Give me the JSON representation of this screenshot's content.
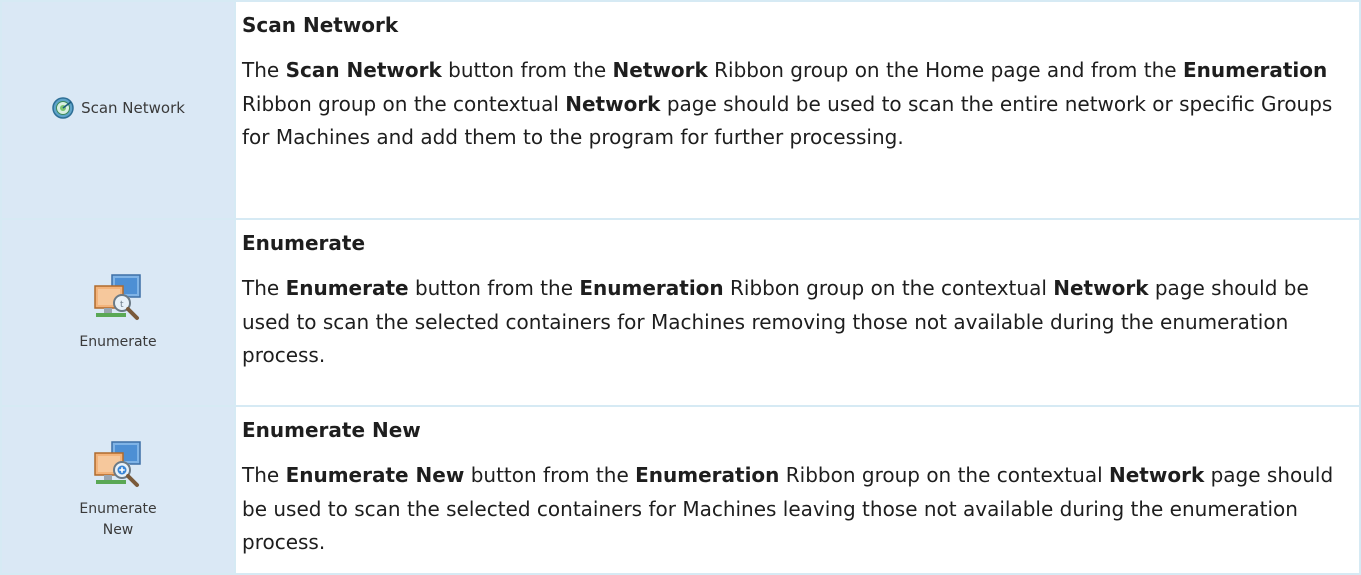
{
  "entries": [
    {
      "button_label": "Scan Network",
      "icon": "scan-network-icon",
      "title": "Scan Network",
      "body": [
        {
          "t": "The ",
          "b": false
        },
        {
          "t": "Scan Network",
          "b": true
        },
        {
          "t": " button from the ",
          "b": false
        },
        {
          "t": "Network",
          "b": true
        },
        {
          "t": " Ribbon group on the Home page and from the ",
          "b": false
        },
        {
          "t": "Enumeration",
          "b": true
        },
        {
          "t": " Ribbon group on the contextual ",
          "b": false
        },
        {
          "t": "Network",
          "b": true
        },
        {
          "t": " page should be used to scan the entire network or specific Groups for Machines and add them to the program for further processing.",
          "b": false
        }
      ]
    },
    {
      "button_label": "Enumerate",
      "icon": "enumerate-icon",
      "title": "Enumerate",
      "body": [
        {
          "t": "The ",
          "b": false
        },
        {
          "t": "Enumerate",
          "b": true
        },
        {
          "t": " button from the ",
          "b": false
        },
        {
          "t": "Enumeration",
          "b": true
        },
        {
          "t": " Ribbon group on the contextual ",
          "b": false
        },
        {
          "t": "Network",
          "b": true
        },
        {
          "t": " page should be used to scan the selected containers for Machines removing those not available during the enumeration process.",
          "b": false
        }
      ]
    },
    {
      "button_label_line1": "Enumerate",
      "button_label_line2": "New",
      "icon": "enumerate-new-icon",
      "title": "Enumerate New",
      "body": [
        {
          "t": "The ",
          "b": false
        },
        {
          "t": "Enumerate New",
          "b": true
        },
        {
          "t": " button from the ",
          "b": false
        },
        {
          "t": "Enumeration",
          "b": true
        },
        {
          "t": " Ribbon group on the contextual ",
          "b": false
        },
        {
          "t": "Network",
          "b": true
        },
        {
          "t": " page should be used to scan the selected containers for Machines leaving those not available during the enumeration process.",
          "b": false
        }
      ]
    }
  ]
}
